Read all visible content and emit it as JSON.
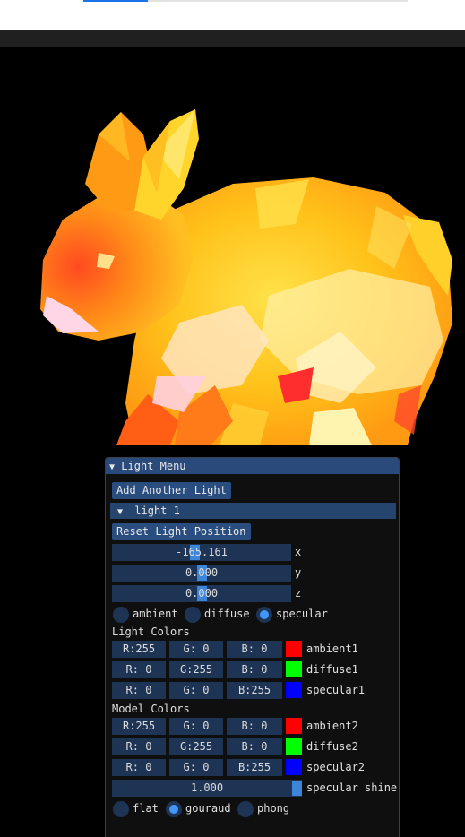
{
  "colors": {
    "top_fill": "#1a73e8",
    "panel_title_bg": "#294a7a",
    "field_bg": "#1e3454",
    "accent": "#4296fa"
  },
  "top_progress_fraction": 0.2,
  "panel": {
    "title": "Light Menu",
    "collapse_icon": "triangle-down",
    "add_light_label": "Add Another Light",
    "light_header": "light 1",
    "reset_position_label": "Reset Light Position",
    "position": [
      {
        "value": "-165.161",
        "axis": "x",
        "fraction": 0.46
      },
      {
        "value": "0.000",
        "axis": "y",
        "fraction": 0.5
      },
      {
        "value": "0.000",
        "axis": "z",
        "fraction": 0.5
      }
    ],
    "light_mode_options": [
      {
        "label": "ambient",
        "selected": false
      },
      {
        "label": "diffuse",
        "selected": false
      },
      {
        "label": "specular",
        "selected": true
      }
    ],
    "light_colors_heading": "Light Colors",
    "light_colors": [
      {
        "r": "R:255",
        "g": "G:  0",
        "b": "B:  0",
        "swatch": "#ff0000",
        "name": "ambient1"
      },
      {
        "r": "R:  0",
        "g": "G:255",
        "b": "B:  0",
        "swatch": "#00ff00",
        "name": "diffuse1"
      },
      {
        "r": "R:  0",
        "g": "G:  0",
        "b": "B:255",
        "swatch": "#0000ff",
        "name": "specular1"
      }
    ],
    "model_colors_heading": "Model Colors",
    "model_colors": [
      {
        "r": "R:255",
        "g": "G:  0",
        "b": "B:  0",
        "swatch": "#ff0000",
        "name": "ambient2"
      },
      {
        "r": "R:  0",
        "g": "G:255",
        "b": "B:  0",
        "swatch": "#00ff00",
        "name": "diffuse2"
      },
      {
        "r": "R:  0",
        "g": "G:  0",
        "b": "B:255",
        "swatch": "#0000ff",
        "name": "specular2"
      }
    ],
    "shine": {
      "value": "1.000",
      "label": "specular shine",
      "fraction": 1.0
    },
    "shading_options": [
      {
        "label": "flat",
        "selected": false
      },
      {
        "label": "gouraud",
        "selected": true
      },
      {
        "label": "phong",
        "selected": false
      }
    ]
  }
}
